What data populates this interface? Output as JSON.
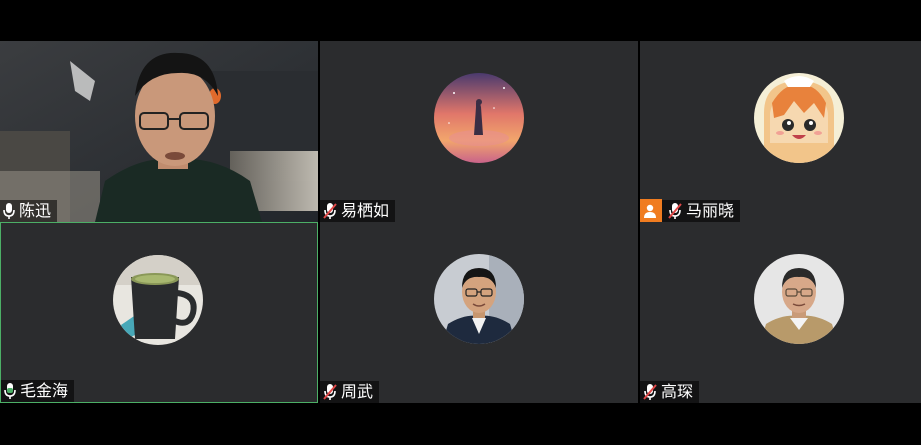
{
  "participants": [
    {
      "name": "陈迅",
      "mic": "on",
      "video": true
    },
    {
      "name": "易栖如",
      "mic": "muted",
      "avatar": "sunset-girl-avatar"
    },
    {
      "name": "马丽晓",
      "mic": "muted",
      "avatar": "anime-avatar",
      "host_icon": "person-icon"
    },
    {
      "name": "毛金海",
      "mic": "speaking",
      "avatar": "tea-cup-avatar",
      "active": true
    },
    {
      "name": "周武",
      "mic": "muted",
      "avatar": "man-glasses-avatar"
    },
    {
      "name": "高琛",
      "mic": "muted",
      "avatar": "older-man-avatar"
    }
  ],
  "colors": {
    "tile": "#2b2c2e",
    "active_border": "#4caf66",
    "host_badge": "#f07c20",
    "muted_icon": "#e04848"
  }
}
